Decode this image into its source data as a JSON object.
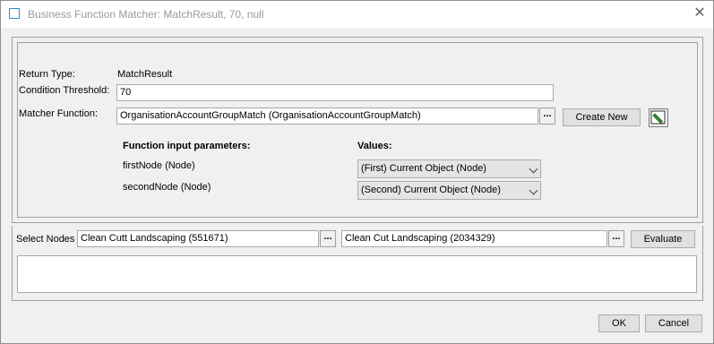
{
  "window": {
    "title": "Business Function Matcher: MatchResult, 70, null",
    "close_glyph": "✕"
  },
  "form": {
    "return_type_label": "Return Type:",
    "return_type_value": "MatchResult",
    "condition_threshold_label": "Condition Threshold:",
    "condition_threshold_value": "70",
    "matcher_function_label": "Matcher Function:",
    "matcher_function_value": "OrganisationAccountGroupMatch (OrganisationAccountGroupMatch)",
    "browse_label": "...",
    "create_new_label": "Create New",
    "edit_icon": "pencil-edit-icon"
  },
  "parameters": {
    "header_left": "Function input parameters:",
    "header_right": "Values:",
    "rows": [
      {
        "name": "firstNode (Node)",
        "value": "(First)  Current Object (Node)"
      },
      {
        "name": "secondNode (Node)",
        "value": "(Second)  Current Object (Node)"
      }
    ]
  },
  "nodes": {
    "label": "Select Nodes",
    "node1": "Clean Cutt Landscaping (551671)",
    "node2": "Clean Cut Landscaping  (2034329)",
    "browse_label": "...",
    "evaluate_label": "Evaluate"
  },
  "footer": {
    "ok_label": "OK",
    "cancel_label": "Cancel"
  }
}
